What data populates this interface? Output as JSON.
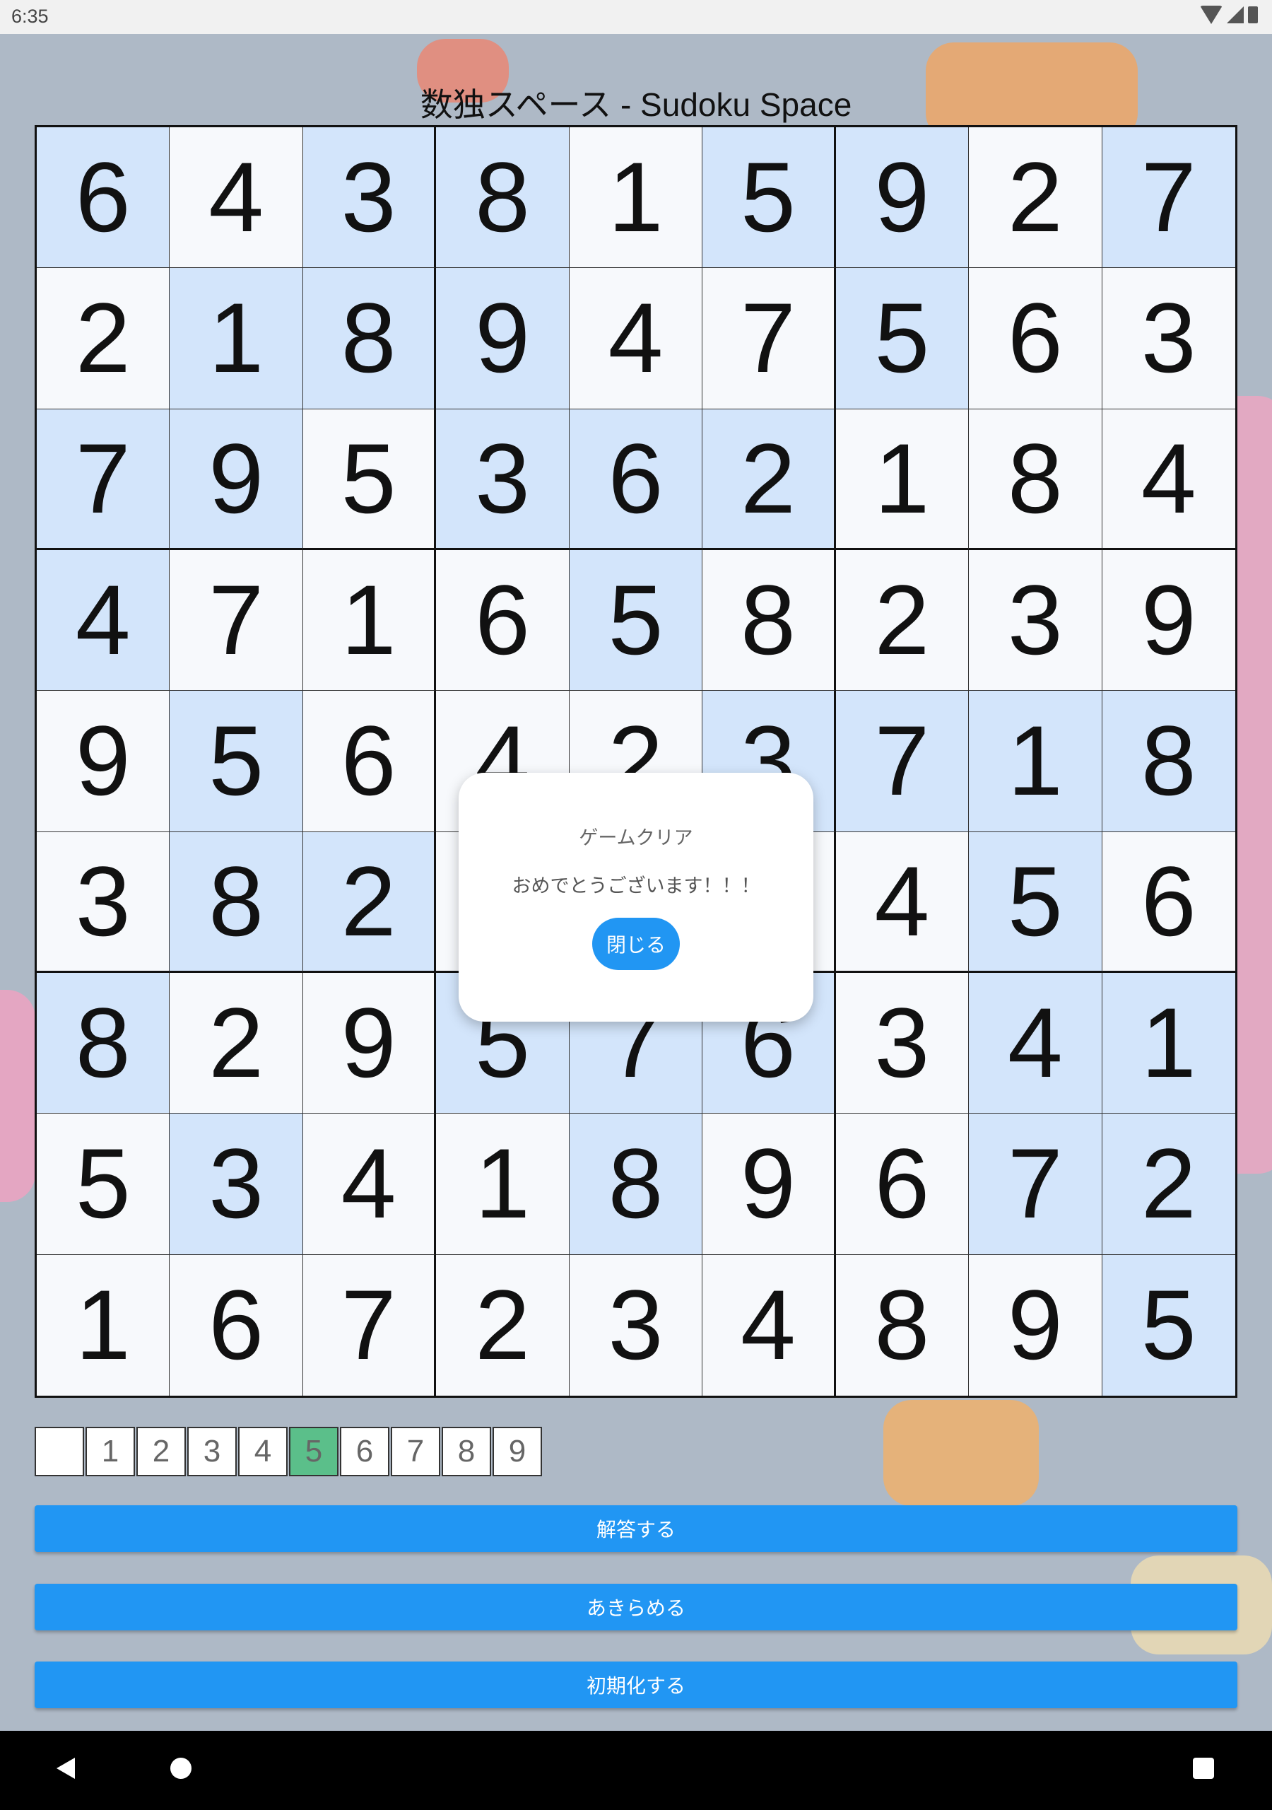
{
  "status_bar": {
    "time": "6:35"
  },
  "title": "数独スペース - Sudoku Space",
  "board": [
    [
      "6",
      "4",
      "3",
      "8",
      "1",
      "5",
      "9",
      "2",
      "7"
    ],
    [
      "2",
      "1",
      "8",
      "9",
      "4",
      "7",
      "5",
      "6",
      "3"
    ],
    [
      "7",
      "9",
      "5",
      "3",
      "6",
      "2",
      "1",
      "8",
      "4"
    ],
    [
      "4",
      "7",
      "1",
      "6",
      "5",
      "8",
      "2",
      "3",
      "9"
    ],
    [
      "9",
      "5",
      "6",
      "4",
      "2",
      "3",
      "7",
      "1",
      "8"
    ],
    [
      "3",
      "8",
      "2",
      "",
      "",
      "",
      "4",
      "5",
      "6"
    ],
    [
      "8",
      "2",
      "9",
      "5",
      "7",
      "6",
      "3",
      "4",
      "1"
    ],
    [
      "5",
      "3",
      "4",
      "1",
      "8",
      "9",
      "6",
      "7",
      "2"
    ],
    [
      "1",
      "6",
      "7",
      "2",
      "3",
      "4",
      "8",
      "9",
      "5"
    ]
  ],
  "board_shading": [
    [
      "b",
      "w",
      "b",
      "b",
      "w",
      "b",
      "b",
      "w",
      "b"
    ],
    [
      "w",
      "b",
      "b",
      "b",
      "w",
      "w",
      "b",
      "w",
      "w"
    ],
    [
      "b",
      "b",
      "w",
      "b",
      "b",
      "b",
      "w",
      "w",
      "w"
    ],
    [
      "b",
      "w",
      "w",
      "w",
      "b",
      "w",
      "w",
      "w",
      "w"
    ],
    [
      "w",
      "b",
      "w",
      "w",
      "w",
      "b",
      "b",
      "b",
      "b"
    ],
    [
      "w",
      "b",
      "b",
      "w",
      "w",
      "w",
      "w",
      "b",
      "w"
    ],
    [
      "b",
      "w",
      "w",
      "b",
      "b",
      "b",
      "w",
      "b",
      "b"
    ],
    [
      "w",
      "b",
      "w",
      "w",
      "b",
      "w",
      "w",
      "b",
      "b"
    ],
    [
      "w",
      "w",
      "w",
      "w",
      "w",
      "w",
      "w",
      "w",
      "b"
    ]
  ],
  "colors": {
    "cell_blue": "#d3e5fb",
    "cell_white": "#f7f9fc",
    "accent": "#2196f3",
    "selected": "#5bbf8a"
  },
  "dialog": {
    "title": "ゲームクリア",
    "message": "おめでとうございます！！！",
    "close_label": "閉じる"
  },
  "palette": {
    "keys": [
      "",
      "1",
      "2",
      "3",
      "4",
      "5",
      "6",
      "7",
      "8",
      "9"
    ],
    "selected": "5"
  },
  "actions": {
    "answer_label": "解答する",
    "give_up_label": "あきらめる",
    "reset_label": "初期化する"
  }
}
